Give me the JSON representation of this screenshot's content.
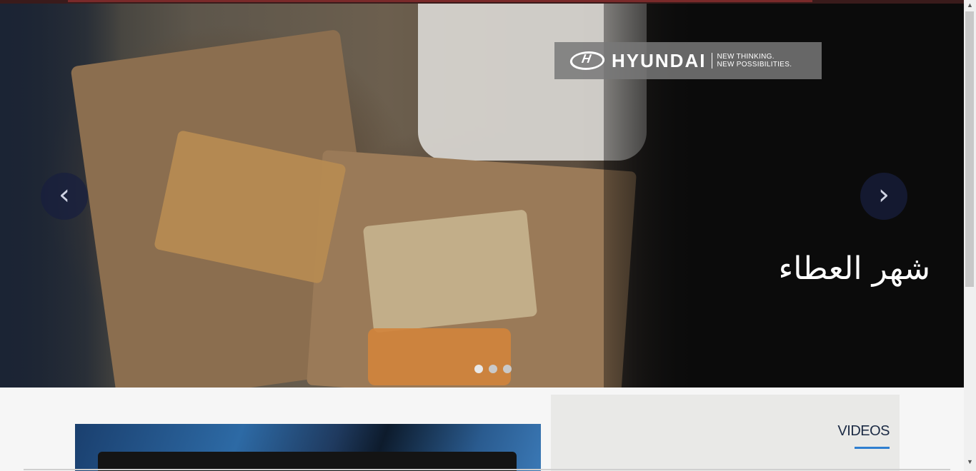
{
  "hero": {
    "brand": {
      "name": "HYUNDAI",
      "tagline_1": "NEW THINKING.",
      "tagline_2": "NEW POSSIBILITIES."
    },
    "caption": "شهر العطاء",
    "prev_icon": "chevron-left-icon",
    "next_icon": "chevron-right-icon",
    "prev_glyph": "‹",
    "next_glyph": "›",
    "slide_count": 3,
    "active_slide": 1
  },
  "videos": {
    "title": "VIDEOS",
    "accent_color": "#2f7fd0"
  },
  "colors": {
    "top_bar": "#3a1b1b",
    "page_bg": "#f6f6f6",
    "videos_panel_bg": "#e9e9e7"
  }
}
